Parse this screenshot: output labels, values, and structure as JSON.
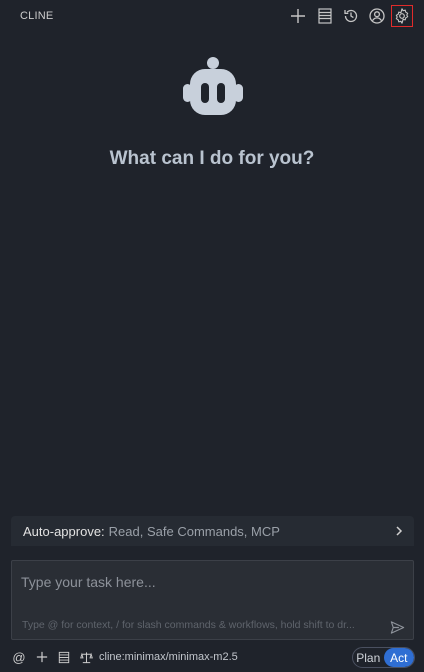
{
  "header": {
    "title": "CLINE",
    "icons": [
      "plus-icon",
      "server-stack-icon",
      "history-icon",
      "account-icon",
      "gear-icon"
    ]
  },
  "welcome": {
    "heading": "What can I do for you?"
  },
  "auto_approve": {
    "label": "Auto-approve:",
    "value": "Read, Safe Commands, MCP"
  },
  "task": {
    "placeholder": "Type your task here...",
    "hint": "Type @ for context, / for slash commands & workflows, hold shift to dr..."
  },
  "footer": {
    "model": "cline:minimax/minimax-m2.5",
    "modes": [
      "Plan",
      "Act"
    ],
    "active_mode": "Act"
  },
  "colors": {
    "background": "#1f232b",
    "accent": "#2f6ed3",
    "highlight_border": "#e02b2b"
  }
}
